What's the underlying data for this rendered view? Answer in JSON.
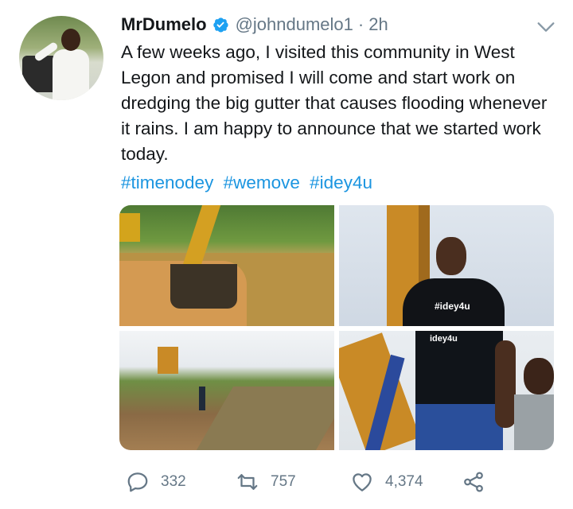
{
  "author": {
    "display_name": "MrDumelo",
    "handle": "@johndumelo1",
    "separator": "·",
    "timestamp": "2h",
    "verified": true
  },
  "tweet": {
    "text": "A few weeks ago, I visited this community in West Legon and promised I will come and start work on dredging the big gutter that causes flooding whenever it rains. I am happy to announce that we started work today.",
    "hashtags": [
      "#timenodey",
      "#wemove",
      "#idey4u"
    ]
  },
  "media": {
    "count": 4,
    "shirt_print_1": "#idey4u",
    "shirt_print_2": "idey4u"
  },
  "actions": {
    "replies": "332",
    "retweets": "757",
    "likes": "4,374"
  },
  "icons": {
    "verified": "verified-badge-icon",
    "caret": "chevron-down-icon",
    "reply": "reply-icon",
    "retweet": "retweet-icon",
    "like": "heart-icon",
    "share": "share-icon"
  },
  "colors": {
    "link": "#1b95e0",
    "muted": "#657786",
    "text": "#14171a"
  }
}
